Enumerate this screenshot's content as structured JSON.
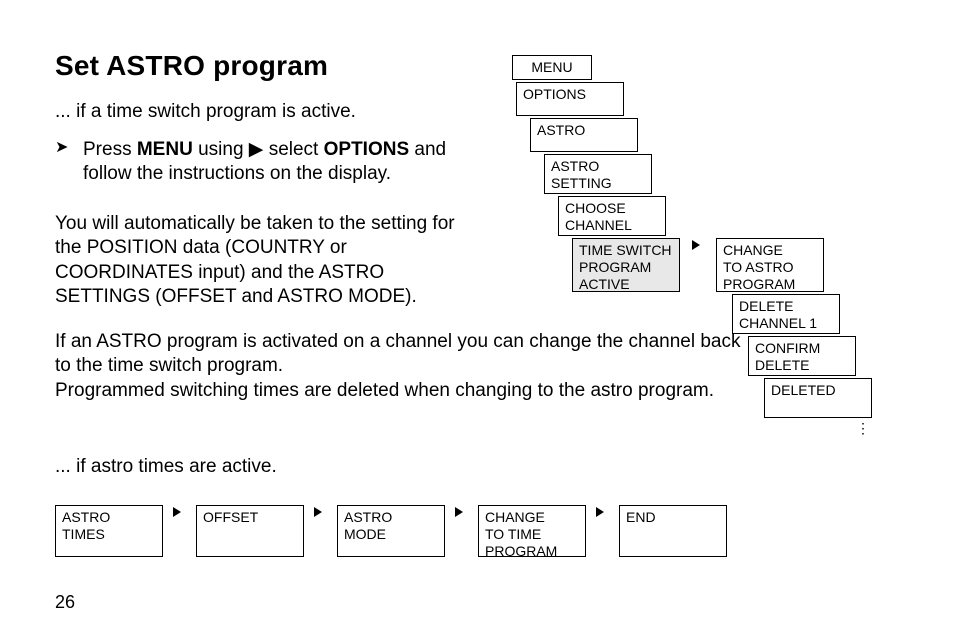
{
  "title": "Set ASTRO program",
  "line_if_tsp_active": "... if a time switch program is active.",
  "bullet_glyph": "➤",
  "bullet_text_prefix": "Press ",
  "bullet_menu": "MENU",
  "bullet_mid": " using ",
  "bullet_arrow": "▶",
  "bullet_mid2": " select ",
  "bullet_options": "OPTIONS",
  "bullet_suffix": " and follow the instructions on the display.",
  "para_position": "You will automatically be taken to the setting for the POSITION data (COUNTRY or COORDINATES input) and the ASTRO SETTINGS (OFFSET and ASTRO MODE).",
  "para_change_back_1": "If an ASTRO program is activated on a channel you can change the channel back to the time switch program.",
  "para_change_back_2": "Programmed switching times are deleted when changing to the astro program.",
  "line_if_astro_active": "... if astro times are active.",
  "page_number": "26",
  "menu_tree": {
    "menu": "MENU",
    "options": "OPTIONS",
    "astro": "ASTRO",
    "astro_setting": "ASTRO\nSETTING",
    "choose_channel": "CHOOSE\nCHANNEL",
    "timeswitch_active": "TIME SWITCH\nPROGRAM\nACTIVE",
    "change_to_astro": "CHANGE\nTO ASTRO\nPROGRAM",
    "delete_ch1": "DELETE\nCHANNEL 1",
    "confirm_delete": "CONFIRM\nDELETE",
    "deleted": "DELETED"
  },
  "bottom_flow": {
    "astro_times": "ASTRO TIMES",
    "offset": "OFFSET",
    "astro_mode": "ASTRO MODE",
    "change_to_time": "CHANGE\nTO TIME\nPROGRAM",
    "end": "END"
  }
}
